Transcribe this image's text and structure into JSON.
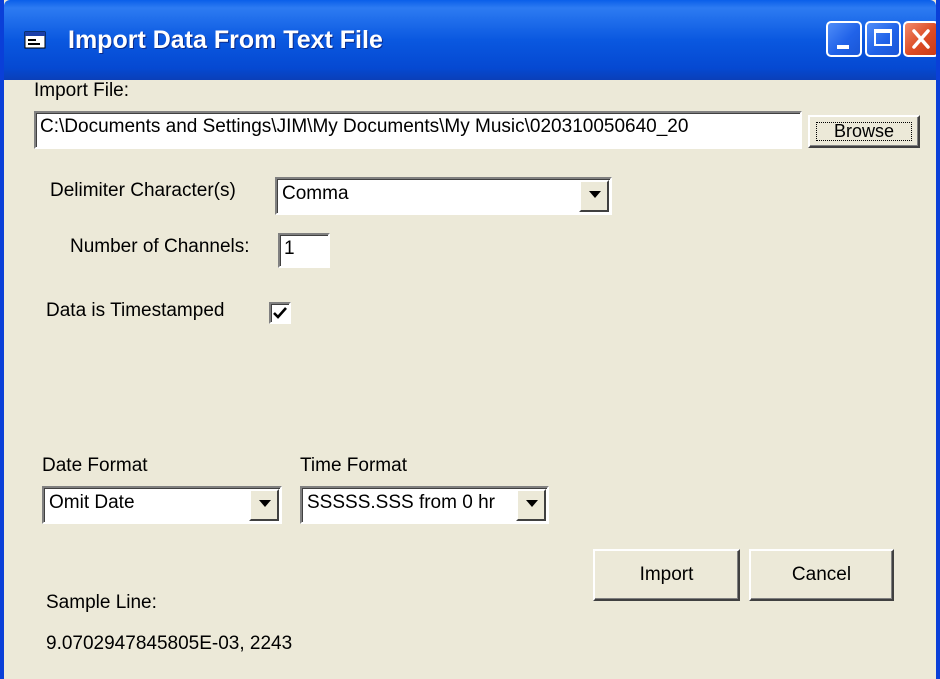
{
  "window": {
    "title": "Import Data From Text File"
  },
  "import_file": {
    "label": "Import File:",
    "path": "C:\\Documents and Settings\\JIM\\My Documents\\My Music\\020310050640_20",
    "browse_label": "Browse"
  },
  "delimiter": {
    "label": "Delimiter Character(s)",
    "value": "Comma"
  },
  "channels": {
    "label": "Number of Channels:",
    "value": "1"
  },
  "timestamped": {
    "label": "Data is Timestamped",
    "checked": true
  },
  "date_format": {
    "label": "Date Format",
    "value": "Omit Date"
  },
  "time_format": {
    "label": "Time Format",
    "value": "SSSSS.SSS from 0 hr"
  },
  "buttons": {
    "import": "Import",
    "cancel": "Cancel"
  },
  "sample": {
    "label": "Sample Line:",
    "value": "9.0702947845805E-03, 2243"
  },
  "colors": {
    "titlebar": "#0a58e0",
    "dialog_bg": "#ece9d8",
    "close_button": "#dc4b24"
  },
  "icons": {
    "window": "window-app-icon",
    "minimize": "minimize-icon",
    "maximize": "maximize-icon",
    "close": "close-icon",
    "dropdown": "chevron-down-icon",
    "check": "checkmark-icon"
  }
}
